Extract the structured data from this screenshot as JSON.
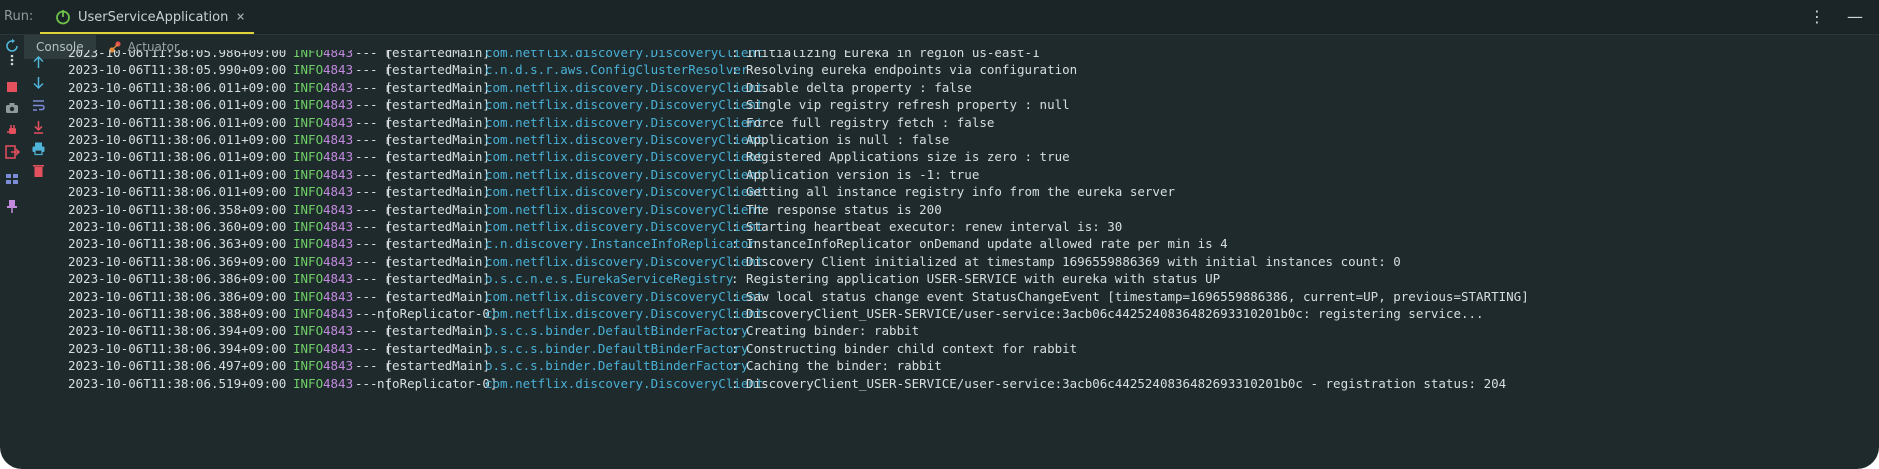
{
  "run_panel": {
    "label": "Run:",
    "tab_label": "UserServiceApplication",
    "tab_close": "×",
    "more_glyph": "⋮",
    "minimize_glyph": "—"
  },
  "subtabs": {
    "console": "Console",
    "actuator": "Actuator"
  },
  "colors": {
    "background": "#1e2a2c",
    "timestamp": "#d8dedf",
    "level_info": "#6fcf67",
    "pid": "#c38adf",
    "logger": "#4ab0d6",
    "active_tab_underline": "#e0d33a"
  },
  "log_lines": [
    {
      "ts": "2023-10-06T11:38:05.986+09:00",
      "level": "INFO",
      "pid": "4843",
      "sep": "--- [",
      "thread": " restartedMain]",
      "logger": "com.netflix.discovery.DiscoveryClient",
      "msg": ": Initializing Eureka in region us-east-1"
    },
    {
      "ts": "2023-10-06T11:38:05.990+09:00",
      "level": "INFO",
      "pid": "4843",
      "sep": "--- [",
      "thread": " restartedMain]",
      "logger": "c.n.d.s.r.aws.ConfigClusterResolver",
      "msg": ": Resolving eureka endpoints via configuration"
    },
    {
      "ts": "2023-10-06T11:38:06.011+09:00",
      "level": "INFO",
      "pid": "4843",
      "sep": "--- [",
      "thread": " restartedMain]",
      "logger": "com.netflix.discovery.DiscoveryClient",
      "msg": ": Disable delta property : false"
    },
    {
      "ts": "2023-10-06T11:38:06.011+09:00",
      "level": "INFO",
      "pid": "4843",
      "sep": "--- [",
      "thread": " restartedMain]",
      "logger": "com.netflix.discovery.DiscoveryClient",
      "msg": ": Single vip registry refresh property : null"
    },
    {
      "ts": "2023-10-06T11:38:06.011+09:00",
      "level": "INFO",
      "pid": "4843",
      "sep": "--- [",
      "thread": " restartedMain]",
      "logger": "com.netflix.discovery.DiscoveryClient",
      "msg": ": Force full registry fetch : false"
    },
    {
      "ts": "2023-10-06T11:38:06.011+09:00",
      "level": "INFO",
      "pid": "4843",
      "sep": "--- [",
      "thread": " restartedMain]",
      "logger": "com.netflix.discovery.DiscoveryClient",
      "msg": ": Application is null : false"
    },
    {
      "ts": "2023-10-06T11:38:06.011+09:00",
      "level": "INFO",
      "pid": "4843",
      "sep": "--- [",
      "thread": " restartedMain]",
      "logger": "com.netflix.discovery.DiscoveryClient",
      "msg": ": Registered Applications size is zero : true"
    },
    {
      "ts": "2023-10-06T11:38:06.011+09:00",
      "level": "INFO",
      "pid": "4843",
      "sep": "--- [",
      "thread": " restartedMain]",
      "logger": "com.netflix.discovery.DiscoveryClient",
      "msg": ": Application version is -1: true"
    },
    {
      "ts": "2023-10-06T11:38:06.011+09:00",
      "level": "INFO",
      "pid": "4843",
      "sep": "--- [",
      "thread": " restartedMain]",
      "logger": "com.netflix.discovery.DiscoveryClient",
      "msg": ": Getting all instance registry info from the eureka server"
    },
    {
      "ts": "2023-10-06T11:38:06.358+09:00",
      "level": "INFO",
      "pid": "4843",
      "sep": "--- [",
      "thread": " restartedMain]",
      "logger": "com.netflix.discovery.DiscoveryClient",
      "msg": ": The response status is 200"
    },
    {
      "ts": "2023-10-06T11:38:06.360+09:00",
      "level": "INFO",
      "pid": "4843",
      "sep": "--- [",
      "thread": " restartedMain]",
      "logger": "com.netflix.discovery.DiscoveryClient",
      "msg": ": Starting heartbeat executor: renew interval is: 30"
    },
    {
      "ts": "2023-10-06T11:38:06.363+09:00",
      "level": "INFO",
      "pid": "4843",
      "sep": "--- [",
      "thread": " restartedMain]",
      "logger": "c.n.discovery.InstanceInfoReplicator",
      "msg": ": InstanceInfoReplicator onDemand update allowed rate per min is 4"
    },
    {
      "ts": "2023-10-06T11:38:06.369+09:00",
      "level": "INFO",
      "pid": "4843",
      "sep": "--- [",
      "thread": " restartedMain]",
      "logger": "com.netflix.discovery.DiscoveryClient",
      "msg": ": Discovery Client initialized at timestamp 1696559886369 with initial instances count: 0"
    },
    {
      "ts": "2023-10-06T11:38:06.386+09:00",
      "level": "INFO",
      "pid": "4843",
      "sep": "--- [",
      "thread": " restartedMain]",
      "logger": "o.s.c.n.e.s.EurekaServiceRegistry",
      "msg": ": Registering application USER-SERVICE with eureka with status UP"
    },
    {
      "ts": "2023-10-06T11:38:06.386+09:00",
      "level": "INFO",
      "pid": "4843",
      "sep": "--- [",
      "thread": " restartedMain]",
      "logger": "com.netflix.discovery.DiscoveryClient",
      "msg": ": Saw local status change event StatusChangeEvent [timestamp=1696559886386, current=UP, previous=STARTING]"
    },
    {
      "ts": "2023-10-06T11:38:06.388+09:00",
      "level": "INFO",
      "pid": "4843",
      "sep": "--- [",
      "thread": "nfoReplicator-0]",
      "logger": "com.netflix.discovery.DiscoveryClient",
      "msg": ": DiscoveryClient_USER-SERVICE/user-service:3acb06c4425240836482693310201b0c: registering service..."
    },
    {
      "ts": "2023-10-06T11:38:06.394+09:00",
      "level": "INFO",
      "pid": "4843",
      "sep": "--- [",
      "thread": " restartedMain]",
      "logger": "o.s.c.s.binder.DefaultBinderFactory",
      "msg": ": Creating binder: rabbit"
    },
    {
      "ts": "2023-10-06T11:38:06.394+09:00",
      "level": "INFO",
      "pid": "4843",
      "sep": "--- [",
      "thread": " restartedMain]",
      "logger": "o.s.c.s.binder.DefaultBinderFactory",
      "msg": ": Constructing binder child context for rabbit"
    },
    {
      "ts": "2023-10-06T11:38:06.497+09:00",
      "level": "INFO",
      "pid": "4843",
      "sep": "--- [",
      "thread": " restartedMain]",
      "logger": "o.s.c.s.binder.DefaultBinderFactory",
      "msg": ": Caching the binder: rabbit"
    },
    {
      "ts": "2023-10-06T11:38:06.519+09:00",
      "level": "INFO",
      "pid": "4843",
      "sep": "--- [",
      "thread": "nfoReplicator-0]",
      "logger": "com.netflix.discovery.DiscoveryClient",
      "msg": ": DiscoveryClient_USER-SERVICE/user-service:3acb06c4425240836482693310201b0c - registration status: 204"
    }
  ]
}
